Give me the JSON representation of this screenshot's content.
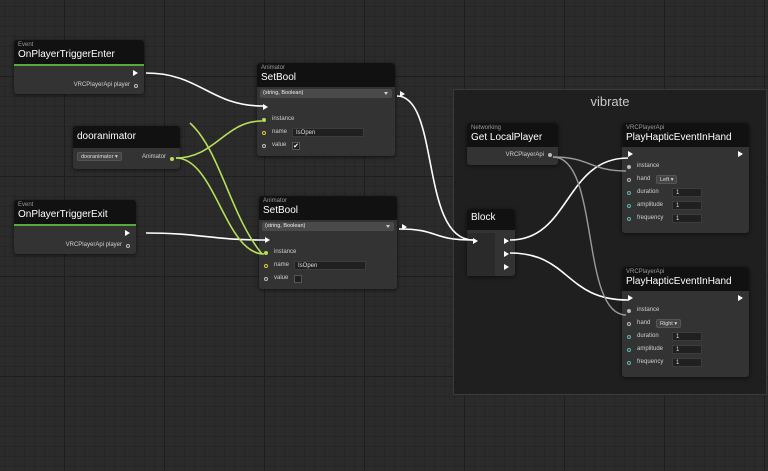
{
  "group_title": "vibrate",
  "nodes": {
    "enter": {
      "sub": "Event",
      "title": "OnPlayerTriggerEnter",
      "out": "VRCPlayerApi player"
    },
    "exit": {
      "sub": "Event",
      "title": "OnPlayerTriggerExit",
      "out": "VRCPlayerApi player"
    },
    "door": {
      "title": "dooranimator",
      "dropdown": "dooranimator",
      "out": "Animator"
    },
    "setbool1": {
      "sub": "Animator",
      "title": "SetBool",
      "signature": "(string, Boolean)",
      "instance": "instance",
      "name_label": "name",
      "name_value": "IsOpen",
      "value_label": "value",
      "value_check": "✔"
    },
    "setbool2": {
      "sub": "Animator",
      "title": "SetBool",
      "signature": "(string, Boolean)",
      "instance": "instance",
      "name_label": "name",
      "name_value": "IsOpen",
      "value_label": "value",
      "value_check": ""
    },
    "local": {
      "sub": "Networking",
      "title": "Get LocalPlayer",
      "out": "VRCPlayerApi"
    },
    "block": {
      "title": "Block"
    },
    "haptic1": {
      "sub": "VRCPlayerApi",
      "title": "PlayHapticEventInHand",
      "instance": "instance",
      "hand_label": "hand",
      "hand_value": "Left",
      "duration_label": "duration",
      "duration": "1",
      "amplitude_label": "amplitude",
      "amplitude": "1",
      "frequency_label": "frequency",
      "frequency": "1"
    },
    "haptic2": {
      "sub": "VRCPlayerApi",
      "title": "PlayHapticEventInHand",
      "instance": "instance",
      "hand_label": "hand",
      "hand_value": "Right",
      "duration_label": "duration",
      "duration": "1",
      "amplitude_label": "amplitude",
      "amplitude": "1",
      "frequency_label": "frequency",
      "frequency": "1"
    }
  },
  "colors": {
    "flow_wire": "#ffffff",
    "animator_wire": "#b7e05a",
    "player_wire": "#9a9a9a",
    "event_accent": "#5aa83c"
  }
}
